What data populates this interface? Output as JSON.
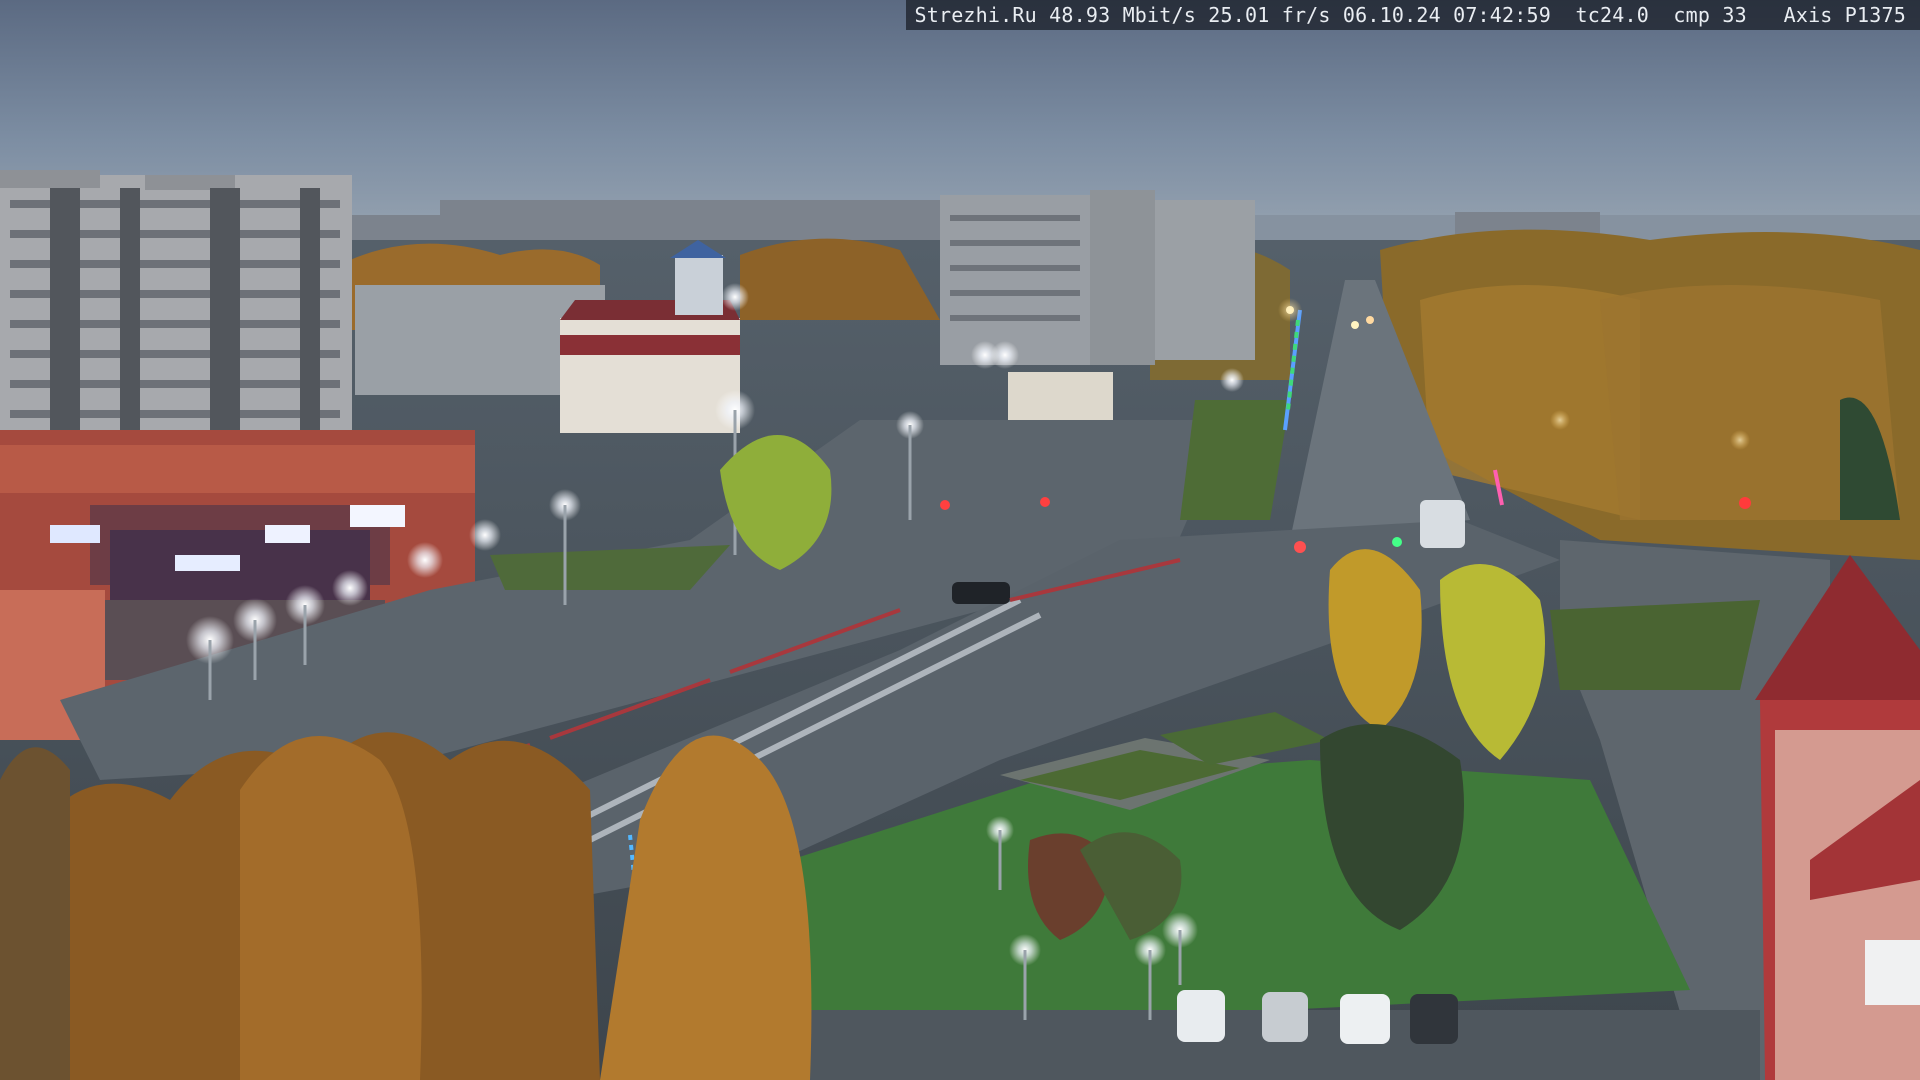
{
  "camera_overlay": {
    "text": "Strezhi.Ru 48.93 Mbit/s 25.01 fr/s 06.10.24 07:42:59  tc24.0  cmp 33   Axis P1375"
  }
}
